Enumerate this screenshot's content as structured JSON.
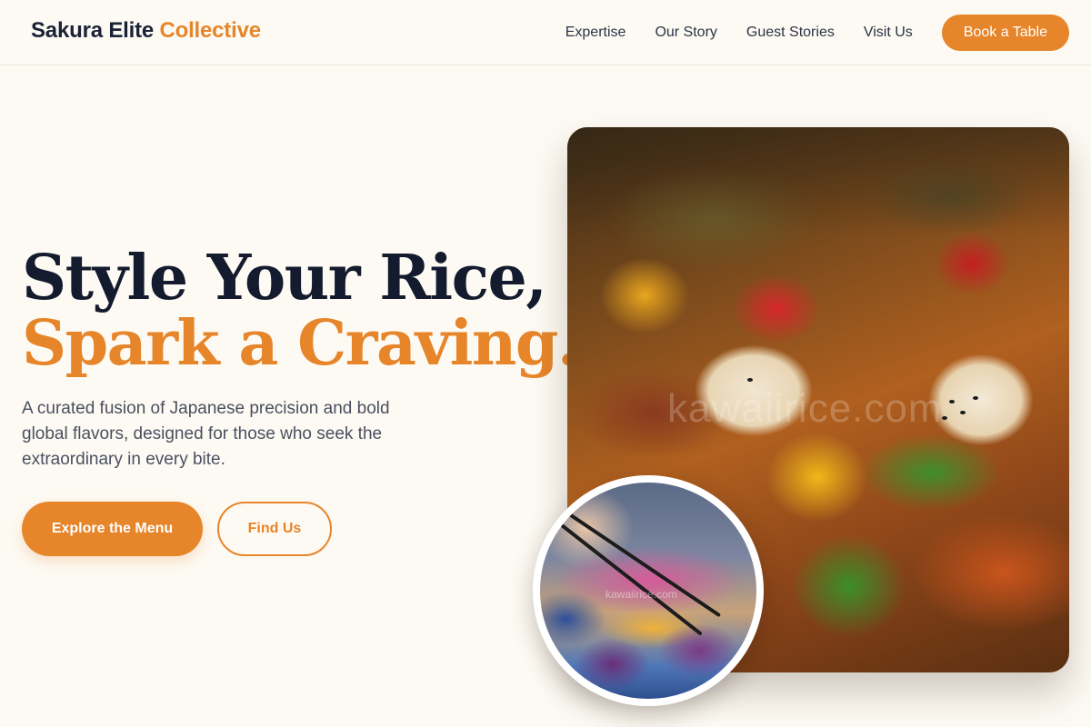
{
  "header": {
    "brand_primary": "Sakura Elite",
    "brand_accent": "Collective",
    "nav": [
      "Expertise",
      "Our Story",
      "Guest Stories",
      "Visit Us"
    ],
    "cta_label": "Book a Table"
  },
  "hero": {
    "title_line1": "Style Your Rice,",
    "title_line2": "Spark a Craving.",
    "description": "A curated fusion of Japanese precision and bold global flavors, designed for those who seek the extraordinary in every bite.",
    "primary_button": "Explore the Menu",
    "secondary_button": "Find Us",
    "image_watermark": "kawaiirice.com",
    "inset_watermark": "kawaiirice.com"
  },
  "colors": {
    "accent": "#e6852a",
    "dark": "#1a2236",
    "background": "#fdfaf3"
  }
}
